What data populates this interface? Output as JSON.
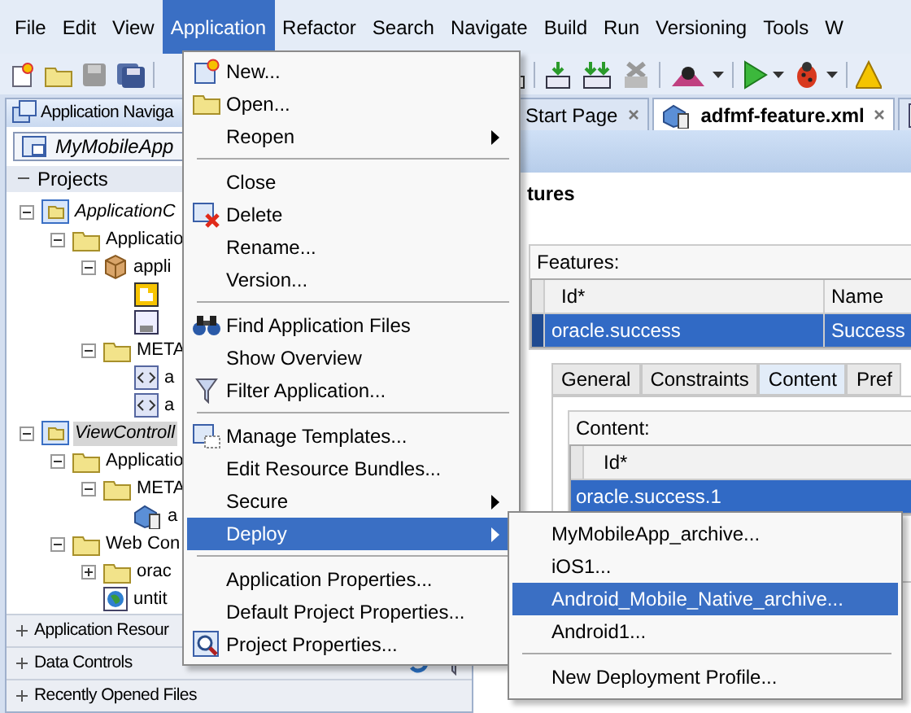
{
  "menubar": [
    {
      "label": "File",
      "selected": false
    },
    {
      "label": "Edit",
      "selected": false
    },
    {
      "label": "View",
      "selected": false
    },
    {
      "label": "Application",
      "selected": true
    },
    {
      "label": "Refactor",
      "selected": false
    },
    {
      "label": "Search",
      "selected": false
    },
    {
      "label": "Navigate",
      "selected": false
    },
    {
      "label": "Build",
      "selected": false
    },
    {
      "label": "Run",
      "selected": false
    },
    {
      "label": "Versioning",
      "selected": false
    },
    {
      "label": "Tools",
      "selected": false
    },
    {
      "label": "W",
      "selected": false
    }
  ],
  "navigator": {
    "title": "Application Naviga",
    "application": "MyMobileApp",
    "section": "Projects",
    "tree": [
      {
        "label": "ApplicationC",
        "kind": "project",
        "expanded": true,
        "selected": false,
        "children": [
          {
            "label": "Applicatio",
            "kind": "folder",
            "expanded": true,
            "selected": false,
            "children": [
              {
                "label": "appli",
                "kind": "package",
                "expanded": true,
                "selected": false,
                "children": [
                  {
                    "kind": "file",
                    "selected": false
                  },
                  {
                    "kind": "class",
                    "selected": false
                  }
                ]
              },
              {
                "label": "META",
                "kind": "folder",
                "expanded": true,
                "selected": false,
                "children": [
                  {
                    "label": "a",
                    "kind": "xml",
                    "selected": false
                  },
                  {
                    "label": "a",
                    "kind": "xml",
                    "selected": false
                  }
                ]
              }
            ]
          }
        ]
      },
      {
        "label": "ViewControll",
        "kind": "project",
        "expanded": true,
        "selected": true,
        "children": [
          {
            "label": "Applicatio",
            "kind": "folder",
            "expanded": true,
            "selected": false,
            "children": [
              {
                "label": "META",
                "kind": "folder",
                "expanded": true,
                "selected": false,
                "children": [
                  {
                    "label": "a",
                    "kind": "mobile",
                    "selected": false
                  }
                ]
              }
            ]
          },
          {
            "label": "Web Con",
            "kind": "folder",
            "expanded": true,
            "selected": false,
            "children": [
              {
                "label": "orac",
                "kind": "folder",
                "expanded": false,
                "selected": false
              },
              {
                "label": "untit",
                "kind": "web",
                "selected": false
              }
            ]
          }
        ]
      }
    ]
  },
  "accordion": [
    {
      "label": "Application Resour",
      "tools": false
    },
    {
      "label": "Data Controls",
      "tools": true
    },
    {
      "label": "Recently Opened Files",
      "tools": false
    }
  ],
  "editor_tabs": [
    {
      "label": "Start Page",
      "selected": false
    },
    {
      "label": "adfmf-feature.xml",
      "selected": true
    },
    {
      "selected": false
    }
  ],
  "heading": "tures",
  "features": {
    "label": "Features:",
    "columns": [
      "Id*",
      "Name"
    ],
    "rows": [
      {
        "cells": [
          "oracle.success",
          "Success"
        ],
        "selected": true
      }
    ]
  },
  "detail_tabs": [
    {
      "label": "General",
      "selected": false
    },
    {
      "label": "Constraints",
      "selected": false
    },
    {
      "label": "Content",
      "selected": true
    },
    {
      "label": "Pref",
      "selected": false
    }
  ],
  "content": {
    "label": "Content:",
    "columns": [
      "Id*"
    ],
    "rows": [
      {
        "cells": [
          "oracle.success.1"
        ],
        "selected": true
      }
    ]
  },
  "menu": [
    {
      "kind": "item",
      "label": "New...",
      "selected": false
    },
    {
      "kind": "item",
      "label": "Open...",
      "selected": false
    },
    {
      "kind": "submenu",
      "label": "Reopen",
      "selected": false
    },
    {
      "kind": "separator"
    },
    {
      "kind": "item",
      "label": "Close",
      "selected": false
    },
    {
      "kind": "item",
      "label": "Delete",
      "selected": false
    },
    {
      "kind": "item",
      "label": "Rename...",
      "selected": false
    },
    {
      "kind": "item",
      "label": "Version...",
      "selected": false
    },
    {
      "kind": "separator"
    },
    {
      "kind": "item",
      "label": "Find Application Files",
      "selected": false
    },
    {
      "kind": "item",
      "label": "Show Overview",
      "selected": false
    },
    {
      "kind": "item",
      "label": "Filter Application...",
      "selected": false
    },
    {
      "kind": "separator"
    },
    {
      "kind": "item",
      "label": "Manage Templates...",
      "selected": false
    },
    {
      "kind": "item",
      "label": "Edit Resource Bundles...",
      "selected": false
    },
    {
      "kind": "submenu",
      "label": "Secure",
      "selected": false
    },
    {
      "kind": "submenu",
      "label": "Deploy",
      "selected": true
    },
    {
      "kind": "separator"
    },
    {
      "kind": "item",
      "label": "Application Properties...",
      "selected": false
    },
    {
      "kind": "item",
      "label": "Default Project Properties...",
      "selected": false
    },
    {
      "kind": "item",
      "label": "Project Properties...",
      "selected": false
    }
  ],
  "submenu": [
    {
      "kind": "item",
      "label": "MyMobileApp_archive...",
      "selected": false
    },
    {
      "kind": "item",
      "label": "iOS1...",
      "selected": false
    },
    {
      "kind": "item",
      "label": "Android_Mobile_Native_archive...",
      "selected": true
    },
    {
      "kind": "item",
      "label": "Android1...",
      "selected": false
    },
    {
      "kind": "separator"
    },
    {
      "kind": "item",
      "label": "New Deployment Profile...",
      "selected": false
    }
  ]
}
